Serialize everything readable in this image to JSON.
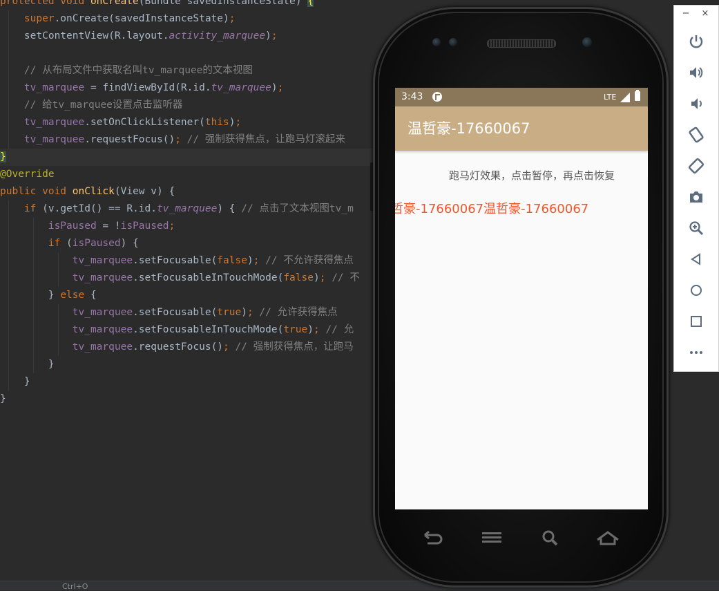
{
  "editor": {
    "lines": [
      [
        "protected void onCreate(Bundle savedInstanceState) {"
      ],
      [
        "    super.onCreate(savedInstanceState);"
      ],
      [
        "    setContentView(R.layout.activity_marquee);"
      ],
      [
        ""
      ],
      [
        "    // 从布局文件中获取名叫tv_marquee的文本视图"
      ],
      [
        "    tv_marquee = findViewById(R.id.tv_marquee);"
      ],
      [
        "    // 给tv_marquee设置点击监听器"
      ],
      [
        "    tv_marquee.setOnClickListener(this);"
      ],
      [
        "    tv_marquee.requestFocus(); // 强制获得焦点，让跑马灯滚起来"
      ],
      [
        "}"
      ],
      [
        "@Override"
      ],
      [
        "public void onClick(View v) {"
      ],
      [
        "    if (v.getId() == R.id.tv_marquee) { // 点击了文本视图tv_m"
      ],
      [
        "        isPaused = !isPaused;"
      ],
      [
        "        if (isPaused) {"
      ],
      [
        "            tv_marquee.setFocusable(false); // 不允许获得焦点"
      ],
      [
        "            tv_marquee.setFocusableInTouchMode(false); // 不"
      ],
      [
        "        } else {"
      ],
      [
        "            tv_marquee.setFocusable(true); // 允许获得焦点"
      ],
      [
        "            tv_marquee.setFocusableInTouchMode(true); // 允"
      ],
      [
        "            tv_marquee.requestFocus(); // 强制获得焦点，让跑马"
      ],
      [
        "        }"
      ],
      [
        "    }"
      ],
      [
        "}"
      ]
    ],
    "status_text": "Ctrl+O"
  },
  "phone": {
    "status_time": "3:43",
    "status_network": "LTE",
    "app_title": "温哲豪-17660067",
    "hint_text": "跑马灯效果，点击暂停，再点击恢复",
    "marquee_text": "哲豪-17660067温哲豪-17660067",
    "nav_icons": [
      "back-icon",
      "menu-icon",
      "search-icon",
      "home-icon"
    ],
    "colors": {
      "statusbar": "#8a7658",
      "appbar": "#c9ae85",
      "marquee": "#f0582c"
    }
  },
  "toolbar": {
    "minimize": "−",
    "close": "×",
    "buttons": [
      "power-icon",
      "volume-up-icon",
      "volume-down-icon",
      "rotate-left-icon",
      "rotate-right-icon",
      "camera-icon",
      "zoom-icon",
      "back-icon",
      "home-icon",
      "overview-icon",
      "more-icon"
    ]
  }
}
